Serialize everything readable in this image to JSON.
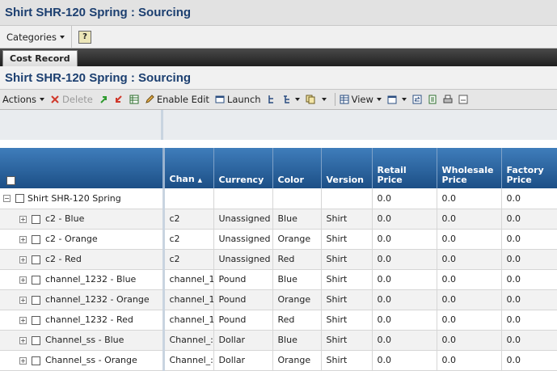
{
  "page_title": "Shirt SHR-120 Spring : Sourcing",
  "menubar": {
    "categories_label": "Categories",
    "help_label": "?"
  },
  "tabs": [
    {
      "label": "Cost Record"
    }
  ],
  "section_title": "Shirt SHR-120 Spring : Sourcing",
  "toolbar": {
    "actions": "Actions",
    "delete": "Delete",
    "enable_edit": "Enable Edit",
    "launch": "Launch",
    "view": "View"
  },
  "columns": [
    "Chan",
    "Currency",
    "Color",
    "Version",
    "Retail Price",
    "Wholesale Price",
    "Factory Price"
  ],
  "root": {
    "name": "Shirt SHR-120 Spring",
    "retail": "0.0",
    "wholesale": "0.0",
    "factory": "0.0"
  },
  "rows": [
    {
      "name": "c2 - Blue",
      "chan": "c2",
      "currency": "Unassigned",
      "color": "Blue",
      "version": "Shirt",
      "retail": "0.0",
      "wholesale": "0.0",
      "factory": "0.0"
    },
    {
      "name": "c2 - Orange",
      "chan": "c2",
      "currency": "Unassigned",
      "color": "Orange",
      "version": "Shirt",
      "retail": "0.0",
      "wholesale": "0.0",
      "factory": "0.0"
    },
    {
      "name": "c2 - Red",
      "chan": "c2",
      "currency": "Unassigned",
      "color": "Red",
      "version": "Shirt",
      "retail": "0.0",
      "wholesale": "0.0",
      "factory": "0.0"
    },
    {
      "name": "channel_1232 - Blue",
      "chan": "channel_1",
      "currency": "Pound",
      "color": "Blue",
      "version": "Shirt",
      "retail": "0.0",
      "wholesale": "0.0",
      "factory": "0.0"
    },
    {
      "name": "channel_1232 - Orange",
      "chan": "channel_1",
      "currency": "Pound",
      "color": "Orange",
      "version": "Shirt",
      "retail": "0.0",
      "wholesale": "0.0",
      "factory": "0.0"
    },
    {
      "name": "channel_1232 - Red",
      "chan": "channel_1",
      "currency": "Pound",
      "color": "Red",
      "version": "Shirt",
      "retail": "0.0",
      "wholesale": "0.0",
      "factory": "0.0"
    },
    {
      "name": "Channel_ss - Blue",
      "chan": "Channel_:",
      "currency": "Dollar",
      "color": "Blue",
      "version": "Shirt",
      "retail": "0.0",
      "wholesale": "0.0",
      "factory": "0.0"
    },
    {
      "name": "Channel_ss - Orange",
      "chan": "Channel_:",
      "currency": "Dollar",
      "color": "Orange",
      "version": "Shirt",
      "retail": "0.0",
      "wholesale": "0.0",
      "factory": "0.0"
    }
  ]
}
